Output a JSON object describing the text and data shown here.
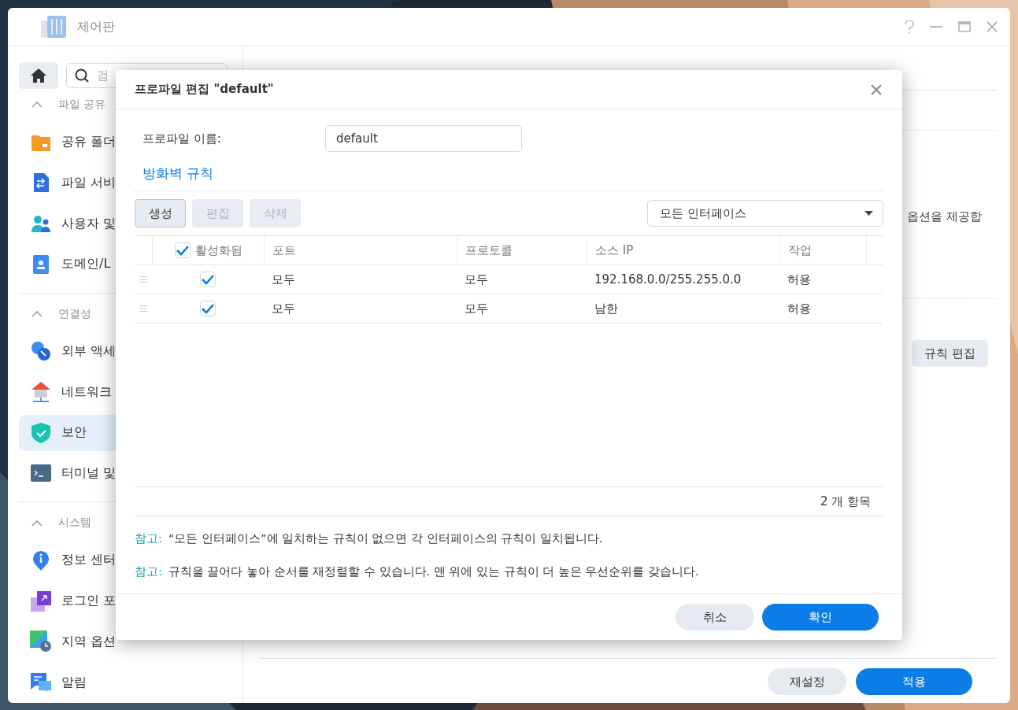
{
  "window": {
    "title": "제어판"
  },
  "sidebar": {
    "search": {
      "placeholder": "검"
    },
    "groups": [
      {
        "title": "파일 공유",
        "expanded": true,
        "items": [
          {
            "label": "공유 폴더",
            "selected": false
          },
          {
            "label": "파일 서비",
            "selected": false
          },
          {
            "label": "사용자 및",
            "selected": false
          },
          {
            "label": "도메인/L",
            "selected": false
          }
        ]
      },
      {
        "title": "연결성",
        "expanded": true,
        "items": [
          {
            "label": "외부 액세",
            "selected": false
          },
          {
            "label": "네트워크",
            "selected": false
          },
          {
            "label": "보안",
            "selected": true
          },
          {
            "label": "터미널 및",
            "selected": false
          }
        ]
      },
      {
        "title": "시스템",
        "expanded": true,
        "items": [
          {
            "label": "정보 센터",
            "selected": false
          },
          {
            "label": "로그인 포",
            "selected": false
          },
          {
            "label": "지역 옵션",
            "selected": false
          },
          {
            "label": "알림",
            "selected": false
          }
        ]
      }
    ]
  },
  "main": {
    "description": "옵션을 제공합",
    "edit_rules_button": "규칙 편집",
    "buttons": [
      {
        "label": "재설정",
        "primary": false
      },
      {
        "label": "적용",
        "primary": true
      }
    ]
  },
  "dialog": {
    "title": "프로파일 편집 \"default\"",
    "profile_name": {
      "label": "프로파일 이름:",
      "value": "default"
    },
    "section_title": "방화벽 규칙",
    "toolbar": [
      {
        "label": "생성",
        "disabled": false
      },
      {
        "label": "편집",
        "disabled": true
      },
      {
        "label": "삭제",
        "disabled": true
      }
    ],
    "interface_select": "모든 인터페이스",
    "table": {
      "header_checked": true,
      "columns": [
        "활성화됨",
        "포트",
        "프로토콜",
        "소스 IP",
        "작업"
      ],
      "rows": [
        {
          "enabled": true,
          "port": "모두",
          "protocol": "모두",
          "source_ip": "192.168.0.0/255.255.0.0",
          "action": "허용"
        },
        {
          "enabled": true,
          "port": "모두",
          "protocol": "모두",
          "source_ip": "남한",
          "action": "허용"
        }
      ]
    },
    "item_count": "2 개 항목",
    "notes": [
      {
        "label": "참고:",
        "text": "“모든 인터페이스”에 일치하는 규칙이 없으면 각 인터페이스의 규칙이 일치됩니다."
      },
      {
        "label": "참고:",
        "text": "규칙을 끌어다 놓아 순서를 재정렬할 수 있습니다. 맨 위에 있는 규칙이 더 높은 우선순위를 갖습니다."
      }
    ],
    "buttons": [
      {
        "label": "취소",
        "primary": false
      },
      {
        "label": "확인",
        "primary": true
      }
    ]
  }
}
